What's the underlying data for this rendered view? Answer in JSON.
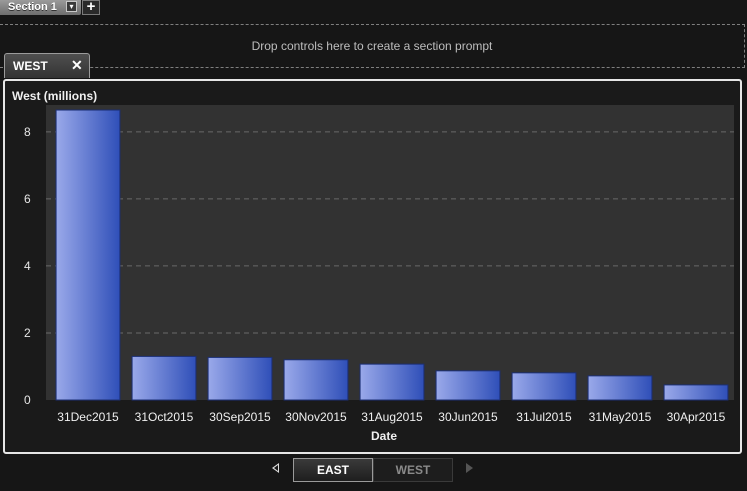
{
  "section": {
    "tab_label": "Section 1",
    "add_label": "+",
    "dropdown_glyph": "▾"
  },
  "prompt_zone": {
    "text": "Drop controls here to create a section prompt"
  },
  "view_tab": {
    "label": "WEST",
    "close_glyph": "✕"
  },
  "chart_data": {
    "type": "bar",
    "title": "West (millions)",
    "xlabel": "Date",
    "ylabel": "",
    "categories": [
      "31Dec2015",
      "31Oct2015",
      "30Sep2015",
      "30Nov2015",
      "31Aug2015",
      "30Jun2015",
      "31Jul2015",
      "31May2015",
      "30Apr2015"
    ],
    "values": [
      8.65,
      1.3,
      1.27,
      1.2,
      1.07,
      0.87,
      0.81,
      0.72,
      0.45
    ],
    "yticks": [
      0,
      2,
      4,
      6,
      8
    ],
    "ylim": [
      0,
      8.8
    ],
    "grid": true,
    "colors": {
      "bar_dark": "#2f4fb8",
      "bar_light": "#9aa9ea",
      "plot_bg": "#323232",
      "grid": "#6a6a6a"
    }
  },
  "pager": {
    "pages": [
      "EAST",
      "WEST"
    ]
  }
}
